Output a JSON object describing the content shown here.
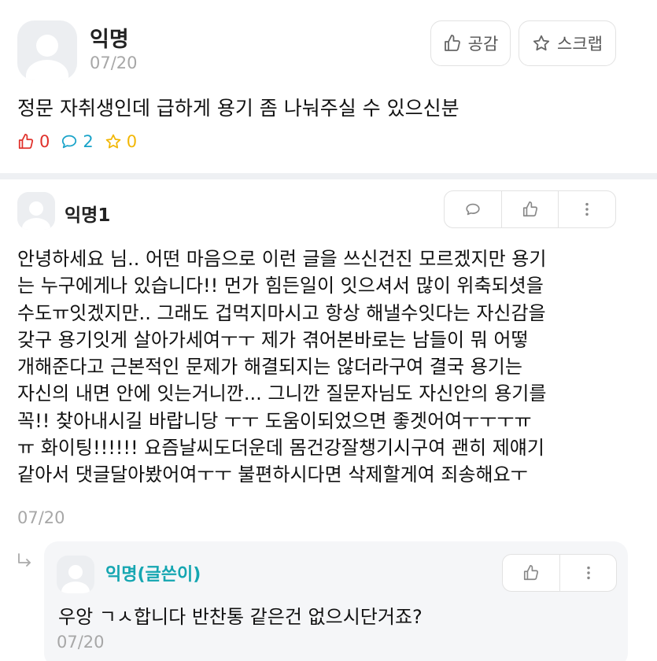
{
  "post": {
    "author": "익명",
    "date": "07/20",
    "like_button": "공감",
    "scrap_button": "스크랩",
    "content": "정문 자취생인데 급하게 용기 좀 나눠주실 수 있으신분",
    "likes": "0",
    "comments": "2",
    "scraps": "0"
  },
  "comment": {
    "author": "익명1",
    "date": "07/20",
    "lines": [
      "안녕하세요 님.. 어떤 마음으로 이런 글을 쓰신건진 모르겠지만 용기",
      "는 누구에게나 있습니다!! 먼가 힘든일이 잇으셔서 많이 위축되셧을",
      "수도ㅠ잇겠지만.. 그래도 겁먹지마시고 항상 해낼수잇다는 자신감을",
      "갖구 용기잇게 살아가세여ㅜㅜ 제가 겪어본바로는 남들이 뭐 어떻",
      "개해준다고 근본적인 문제가 해결되지는 않더라구여 결국 용기는",
      "자신의 내면 안에 잇는거니깐... 그니깐 질문자님도 자신안의 용기를",
      "꼭!! 찾아내시길 바랍니당 ㅜㅜ 도움이되었으면 좋겟어여ㅜㅜㅜㅠ",
      "ㅠ 화이팅!!!!!! 요즘날씨도더운데 몸건강잘챙기시구여 괜히 제얘기",
      "같아서 댓글달아봤어여ㅜㅜ 불편하시다면 삭제할게여 죄송해요ㅜ"
    ]
  },
  "reply": {
    "author": "익명(글쓴이)",
    "content": "우앙 ㄱㅅ합니다 반찬통 같은건 없으시단거죠?",
    "date": "07/20"
  },
  "colors": {
    "like": "#e0302a",
    "comment": "#19a3c9",
    "scrap": "#f2b705",
    "writer": "#15a6b1"
  }
}
